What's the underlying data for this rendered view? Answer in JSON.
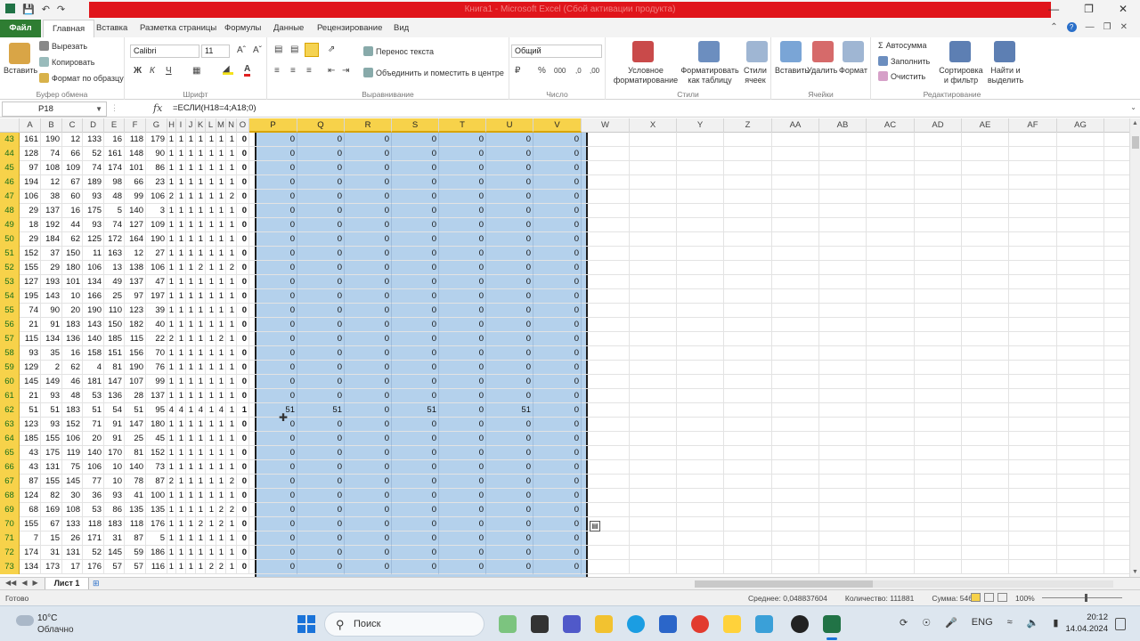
{
  "titlebar": {
    "title_obscured": "Книга1 - Microsoft Excel (Сбой активации продукта)"
  },
  "tabs": [
    "Файл",
    "Главная",
    "Вставка",
    "Разметка страницы",
    "Формулы",
    "Данные",
    "Рецензирование",
    "Вид"
  ],
  "ribbon": {
    "clipboard": {
      "paste": "Вставить",
      "cut": "Вырезать",
      "copy": "Копировать",
      "format_painter": "Формат по образцу",
      "label": "Буфер обмена"
    },
    "font": {
      "name": "Calibri",
      "size": "11",
      "bold": "Ж",
      "italic": "К",
      "underline": "Ч",
      "label": "Шрифт"
    },
    "alignment": {
      "wrap": "Перенос текста",
      "merge": "Объединить и поместить в центре",
      "label": "Выравнивание"
    },
    "number": {
      "format": "Общий",
      "label": "Число"
    },
    "styles": {
      "conditional": "Условное форматирование",
      "as_table": "Форматировать как таблицу",
      "cell_styles": "Стили ячеек",
      "label": "Стили"
    },
    "cells": {
      "insert": "Вставить",
      "delete": "Удалить",
      "format": "Формат",
      "label": "Ячейки"
    },
    "editing": {
      "autosum": "Автосумма",
      "fill": "Заполнить",
      "clear": "Очистить",
      "sort": "Сортировка и фильтр",
      "find": "Найти и выделить",
      "label": "Редактирование"
    }
  },
  "formula_bar": {
    "name_box": "P18",
    "fx": "fx",
    "formula": "=ЕСЛИ(H18=4;A18;0)"
  },
  "grid": {
    "columns": [
      "A",
      "B",
      "C",
      "D",
      "E",
      "F",
      "G",
      "H",
      "I",
      "J",
      "K",
      "L",
      "M",
      "N",
      "O",
      "P",
      "Q",
      "R",
      "S",
      "T",
      "U",
      "V",
      "W",
      "X",
      "Y",
      "Z",
      "AA",
      "AB",
      "AC",
      "AD",
      "AE",
      "AF",
      "AG"
    ],
    "selected_columns": [
      "P",
      "Q",
      "R",
      "S",
      "T",
      "U",
      "V"
    ],
    "rows": [
      {
        "n": "43",
        "v": [
          "161",
          "190",
          "12",
          "133",
          "16",
          "118",
          "179",
          "1",
          "1",
          "1",
          "1",
          "1",
          "1",
          "1",
          "0",
          "0",
          "0",
          "0",
          "0",
          "0",
          "0",
          "0"
        ]
      },
      {
        "n": "44",
        "v": [
          "128",
          "74",
          "66",
          "52",
          "161",
          "148",
          "90",
          "1",
          "1",
          "1",
          "1",
          "1",
          "1",
          "1",
          "0",
          "0",
          "0",
          "0",
          "0",
          "0",
          "0",
          "0"
        ]
      },
      {
        "n": "45",
        "v": [
          "97",
          "108",
          "109",
          "74",
          "174",
          "101",
          "86",
          "1",
          "1",
          "1",
          "1",
          "1",
          "1",
          "1",
          "0",
          "0",
          "0",
          "0",
          "0",
          "0",
          "0",
          "0"
        ]
      },
      {
        "n": "46",
        "v": [
          "194",
          "12",
          "67",
          "189",
          "98",
          "66",
          "23",
          "1",
          "1",
          "1",
          "1",
          "1",
          "1",
          "1",
          "0",
          "0",
          "0",
          "0",
          "0",
          "0",
          "0",
          "0"
        ]
      },
      {
        "n": "47",
        "v": [
          "106",
          "38",
          "60",
          "93",
          "48",
          "99",
          "106",
          "2",
          "1",
          "1",
          "1",
          "1",
          "1",
          "2",
          "0",
          "0",
          "0",
          "0",
          "0",
          "0",
          "0",
          "0"
        ]
      },
      {
        "n": "48",
        "v": [
          "29",
          "137",
          "16",
          "175",
          "5",
          "140",
          "3",
          "1",
          "1",
          "1",
          "1",
          "1",
          "1",
          "1",
          "0",
          "0",
          "0",
          "0",
          "0",
          "0",
          "0",
          "0"
        ]
      },
      {
        "n": "49",
        "v": [
          "18",
          "192",
          "44",
          "93",
          "74",
          "127",
          "109",
          "1",
          "1",
          "1",
          "1",
          "1",
          "1",
          "1",
          "0",
          "0",
          "0",
          "0",
          "0",
          "0",
          "0",
          "0"
        ]
      },
      {
        "n": "50",
        "v": [
          "29",
          "184",
          "62",
          "125",
          "172",
          "164",
          "190",
          "1",
          "1",
          "1",
          "1",
          "1",
          "1",
          "1",
          "0",
          "0",
          "0",
          "0",
          "0",
          "0",
          "0",
          "0"
        ]
      },
      {
        "n": "51",
        "v": [
          "152",
          "37",
          "150",
          "11",
          "163",
          "12",
          "27",
          "1",
          "1",
          "1",
          "1",
          "1",
          "1",
          "1",
          "0",
          "0",
          "0",
          "0",
          "0",
          "0",
          "0",
          "0"
        ]
      },
      {
        "n": "52",
        "v": [
          "155",
          "29",
          "180",
          "106",
          "13",
          "138",
          "106",
          "1",
          "1",
          "1",
          "2",
          "1",
          "1",
          "2",
          "0",
          "0",
          "0",
          "0",
          "0",
          "0",
          "0",
          "0"
        ]
      },
      {
        "n": "53",
        "v": [
          "127",
          "193",
          "101",
          "134",
          "49",
          "137",
          "47",
          "1",
          "1",
          "1",
          "1",
          "1",
          "1",
          "1",
          "0",
          "0",
          "0",
          "0",
          "0",
          "0",
          "0",
          "0"
        ]
      },
      {
        "n": "54",
        "v": [
          "195",
          "143",
          "10",
          "166",
          "25",
          "97",
          "197",
          "1",
          "1",
          "1",
          "1",
          "1",
          "1",
          "1",
          "0",
          "0",
          "0",
          "0",
          "0",
          "0",
          "0",
          "0"
        ]
      },
      {
        "n": "55",
        "v": [
          "74",
          "90",
          "20",
          "190",
          "110",
          "123",
          "39",
          "1",
          "1",
          "1",
          "1",
          "1",
          "1",
          "1",
          "0",
          "0",
          "0",
          "0",
          "0",
          "0",
          "0",
          "0"
        ]
      },
      {
        "n": "56",
        "v": [
          "21",
          "91",
          "183",
          "143",
          "150",
          "182",
          "40",
          "1",
          "1",
          "1",
          "1",
          "1",
          "1",
          "1",
          "0",
          "0",
          "0",
          "0",
          "0",
          "0",
          "0",
          "0"
        ]
      },
      {
        "n": "57",
        "v": [
          "115",
          "134",
          "136",
          "140",
          "185",
          "115",
          "22",
          "2",
          "1",
          "1",
          "1",
          "1",
          "2",
          "1",
          "0",
          "0",
          "0",
          "0",
          "0",
          "0",
          "0",
          "0"
        ]
      },
      {
        "n": "58",
        "v": [
          "93",
          "35",
          "16",
          "158",
          "151",
          "156",
          "70",
          "1",
          "1",
          "1",
          "1",
          "1",
          "1",
          "1",
          "0",
          "0",
          "0",
          "0",
          "0",
          "0",
          "0",
          "0"
        ]
      },
      {
        "n": "59",
        "v": [
          "129",
          "2",
          "62",
          "4",
          "81",
          "190",
          "76",
          "1",
          "1",
          "1",
          "1",
          "1",
          "1",
          "1",
          "0",
          "0",
          "0",
          "0",
          "0",
          "0",
          "0",
          "0"
        ]
      },
      {
        "n": "60",
        "v": [
          "145",
          "149",
          "46",
          "181",
          "147",
          "107",
          "99",
          "1",
          "1",
          "1",
          "1",
          "1",
          "1",
          "1",
          "0",
          "0",
          "0",
          "0",
          "0",
          "0",
          "0",
          "0"
        ]
      },
      {
        "n": "61",
        "v": [
          "21",
          "93",
          "48",
          "53",
          "136",
          "28",
          "137",
          "1",
          "1",
          "1",
          "1",
          "1",
          "1",
          "1",
          "0",
          "0",
          "0",
          "0",
          "0",
          "0",
          "0",
          "0"
        ]
      },
      {
        "n": "62",
        "v": [
          "51",
          "51",
          "183",
          "51",
          "54",
          "51",
          "95",
          "4",
          "4",
          "1",
          "4",
          "1",
          "4",
          "1",
          "1",
          "51",
          "51",
          "0",
          "51",
          "0",
          "51",
          "0"
        ]
      },
      {
        "n": "63",
        "v": [
          "123",
          "93",
          "152",
          "71",
          "91",
          "147",
          "180",
          "1",
          "1",
          "1",
          "1",
          "1",
          "1",
          "1",
          "0",
          "0",
          "0",
          "0",
          "0",
          "0",
          "0",
          "0"
        ]
      },
      {
        "n": "64",
        "v": [
          "185",
          "155",
          "106",
          "20",
          "91",
          "25",
          "45",
          "1",
          "1",
          "1",
          "1",
          "1",
          "1",
          "1",
          "0",
          "0",
          "0",
          "0",
          "0",
          "0",
          "0",
          "0"
        ]
      },
      {
        "n": "65",
        "v": [
          "43",
          "175",
          "119",
          "140",
          "170",
          "81",
          "152",
          "1",
          "1",
          "1",
          "1",
          "1",
          "1",
          "1",
          "0",
          "0",
          "0",
          "0",
          "0",
          "0",
          "0",
          "0"
        ]
      },
      {
        "n": "66",
        "v": [
          "43",
          "131",
          "75",
          "106",
          "10",
          "140",
          "73",
          "1",
          "1",
          "1",
          "1",
          "1",
          "1",
          "1",
          "0",
          "0",
          "0",
          "0",
          "0",
          "0",
          "0",
          "0"
        ]
      },
      {
        "n": "67",
        "v": [
          "87",
          "155",
          "145",
          "77",
          "10",
          "78",
          "87",
          "2",
          "1",
          "1",
          "1",
          "1",
          "1",
          "2",
          "0",
          "0",
          "0",
          "0",
          "0",
          "0",
          "0",
          "0"
        ]
      },
      {
        "n": "68",
        "v": [
          "124",
          "82",
          "30",
          "36",
          "93",
          "41",
          "100",
          "1",
          "1",
          "1",
          "1",
          "1",
          "1",
          "1",
          "0",
          "0",
          "0",
          "0",
          "0",
          "0",
          "0",
          "0"
        ]
      },
      {
        "n": "69",
        "v": [
          "68",
          "169",
          "108",
          "53",
          "86",
          "135",
          "135",
          "1",
          "1",
          "1",
          "1",
          "1",
          "2",
          "2",
          "0",
          "0",
          "0",
          "0",
          "0",
          "0",
          "0",
          "0"
        ]
      },
      {
        "n": "70",
        "v": [
          "155",
          "67",
          "133",
          "118",
          "183",
          "118",
          "176",
          "1",
          "1",
          "1",
          "2",
          "1",
          "2",
          "1",
          "0",
          "0",
          "0",
          "0",
          "0",
          "0",
          "0",
          "0"
        ]
      },
      {
        "n": "71",
        "v": [
          "7",
          "15",
          "26",
          "171",
          "31",
          "87",
          "5",
          "1",
          "1",
          "1",
          "1",
          "1",
          "1",
          "1",
          "0",
          "0",
          "0",
          "0",
          "0",
          "0",
          "0",
          "0"
        ]
      },
      {
        "n": "72",
        "v": [
          "174",
          "31",
          "131",
          "52",
          "145",
          "59",
          "186",
          "1",
          "1",
          "1",
          "1",
          "1",
          "1",
          "1",
          "0",
          "0",
          "0",
          "0",
          "0",
          "0",
          "0",
          "0"
        ]
      },
      {
        "n": "73",
        "v": [
          "134",
          "173",
          "17",
          "176",
          "57",
          "57",
          "116",
          "1",
          "1",
          "1",
          "1",
          "2",
          "2",
          "1",
          "0",
          "0",
          "0",
          "0",
          "0",
          "0",
          "0",
          "0"
        ]
      }
    ]
  },
  "sheet": {
    "tab": "Лист 1"
  },
  "status": {
    "ready": "Готово",
    "average": "Среднее: 0,048837604",
    "count": "Количество: 111881",
    "sum": "Сумма: 5464",
    "zoom": "100%"
  },
  "taskbar": {
    "temp": "10°C",
    "weather": "Облачно",
    "search": "Поиск",
    "lang": "ENG",
    "time": "20:12",
    "date": "14.04.2024"
  }
}
